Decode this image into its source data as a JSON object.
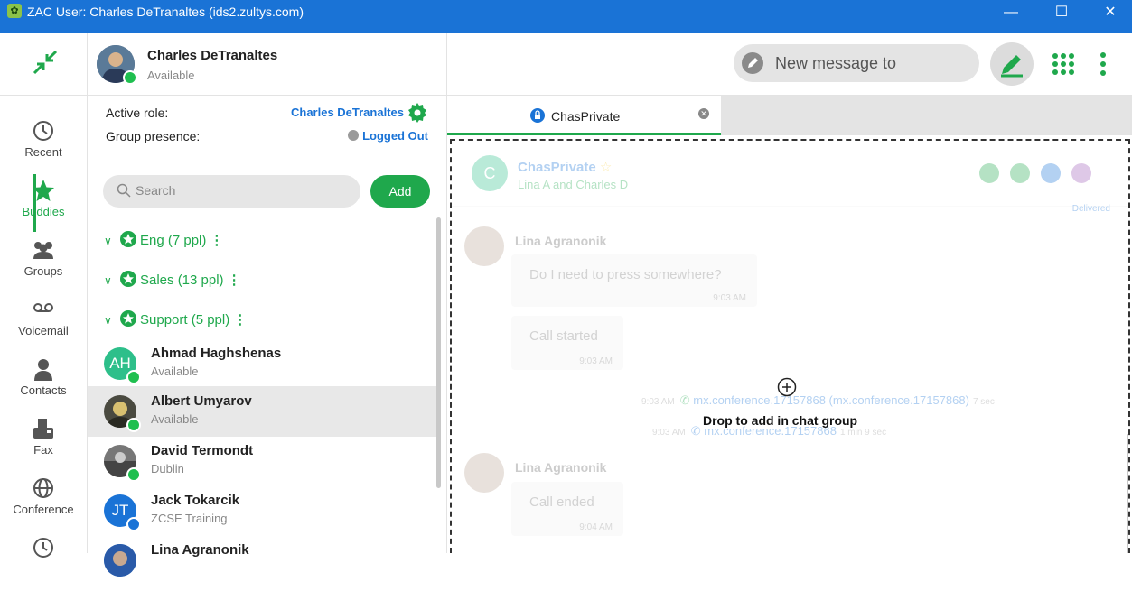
{
  "window": {
    "title": "ZAC User: Charles DeTranaltes (ids2.zultys.com)",
    "minimize": "—",
    "maximize": "☐",
    "close": "✕"
  },
  "rail": {
    "items": [
      {
        "label": "Recent",
        "icon": "clock-icon"
      },
      {
        "label": "Buddies",
        "icon": "star-icon"
      },
      {
        "label": "Groups",
        "icon": "group-icon"
      },
      {
        "label": "Voicemail",
        "icon": "voicemail-icon"
      },
      {
        "label": "Contacts",
        "icon": "person-icon"
      },
      {
        "label": "Fax",
        "icon": "fax-icon"
      },
      {
        "label": "Conference",
        "icon": "globe-icon"
      }
    ],
    "active": "Buddies"
  },
  "me": {
    "name": "Charles DeTranaltes",
    "status": "Available"
  },
  "role": {
    "active_label": "Active role:",
    "active_value": "Charles DeTranaltes",
    "group_label": "Group presence:",
    "group_value": "Logged Out"
  },
  "search": {
    "placeholder": "Search",
    "add_label": "Add"
  },
  "groups": [
    {
      "label": "Eng (7 ppl)"
    },
    {
      "label": "Sales (13 ppl)"
    },
    {
      "label": "Support (5 ppl)"
    }
  ],
  "contacts": [
    {
      "name": "Ahmad Haghshenas",
      "status": "Available",
      "initials": "AH"
    },
    {
      "name": "Albert Umyarov",
      "status": "Available"
    },
    {
      "name": "David Termondt",
      "status": "Dublin"
    },
    {
      "name": "Jack Tokarcik",
      "status": "ZCSE Training",
      "initials": "JT"
    },
    {
      "name": "Lina Agranonik",
      "status": ""
    }
  ],
  "header": {
    "new_message_placeholder": "New message to"
  },
  "tab": {
    "label": "ChasPrivate"
  },
  "chat": {
    "title": "ChasPrivate",
    "subtitle": "Lina A and Charles D",
    "avatar_letter": "C",
    "delivered": "Delivered",
    "messages": [
      {
        "sender": "Lina Agranonik",
        "text": "Do I need to press somewhere?",
        "time": "9:03 AM"
      },
      {
        "text": "Call started",
        "time": "9:03 AM"
      },
      {
        "sender": "Lina Agranonik",
        "text": "Call ended",
        "time": "9:04 AM"
      }
    ],
    "calls": [
      {
        "time": "9:03 AM",
        "text": "mx.conference.17157868 (mx.conference.17157868)",
        "duration": "7 sec"
      },
      {
        "time": "9:03 AM",
        "text": "mx.conference.17157868",
        "duration": "1 min 9 sec"
      }
    ],
    "drop_label": "Drop to add in chat group"
  },
  "colors": {
    "accent": "#1fa84c",
    "brand": "#1a73d6"
  }
}
